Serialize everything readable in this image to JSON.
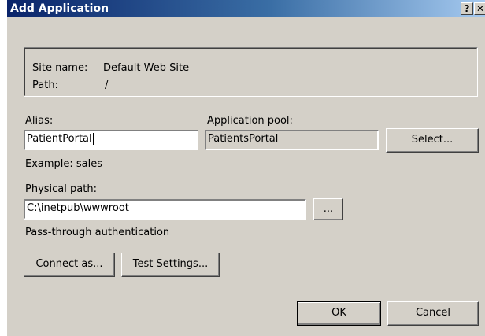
{
  "window": {
    "title": "Add Application",
    "help_label": "?",
    "close_label": "✕"
  },
  "info": {
    "site_name_label": "Site name:",
    "site_name_value": "Default Web Site",
    "path_label": "Path:",
    "path_value": "/"
  },
  "alias": {
    "label": "Alias:",
    "value": "PatientPortal",
    "example": "Example: sales"
  },
  "app_pool": {
    "label": "Application pool:",
    "value": "PatientsPortal",
    "select_label": "Select..."
  },
  "physical_path": {
    "label": "Physical path:",
    "value": "C:\\inetpub\\wwwroot",
    "browse_label": "..."
  },
  "auth": {
    "label": "Pass-through authentication",
    "connect_as_label": "Connect as...",
    "test_settings_label": "Test Settings..."
  },
  "footer": {
    "ok_label": "OK",
    "cancel_label": "Cancel"
  }
}
